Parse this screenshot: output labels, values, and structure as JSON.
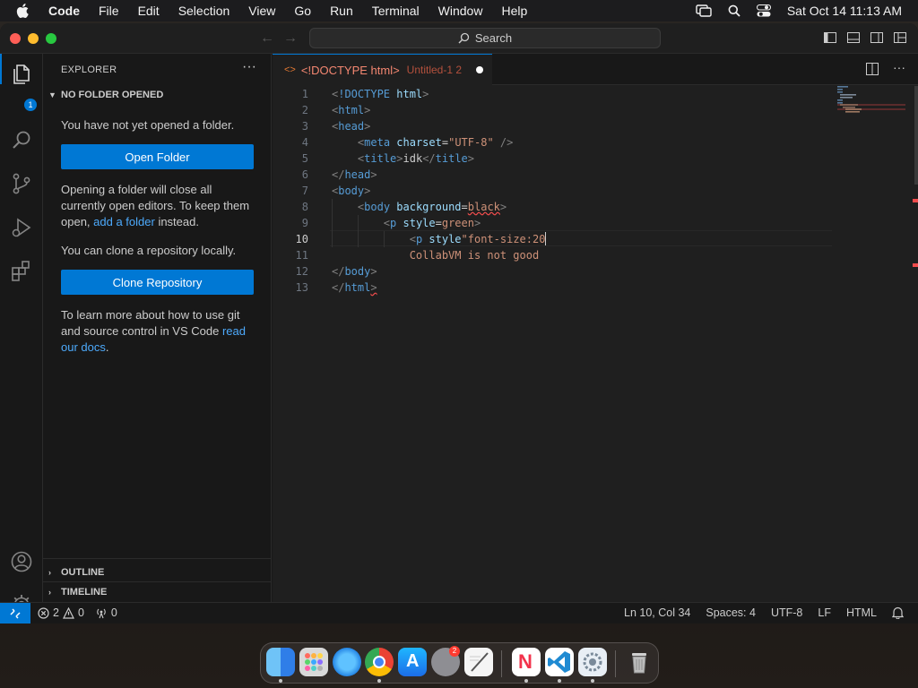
{
  "menubar": {
    "app_name": "Code",
    "items": [
      "File",
      "Edit",
      "Selection",
      "View",
      "Go",
      "Run",
      "Terminal",
      "Window",
      "Help"
    ],
    "datetime": "Sat Oct 14  11:13 AM"
  },
  "titlebar": {
    "search_label": "Search"
  },
  "activity": {
    "explorer_badge": "1"
  },
  "sidebar": {
    "header": "EXPLORER",
    "more": "···",
    "section_title": "NO FOLDER OPENED",
    "no_folder_text": "You have not yet opened a folder.",
    "open_folder_button": "Open Folder",
    "opening_text_1": "Opening a folder will close all currently open editors. To keep them open, ",
    "add_folder_link": "add a folder",
    "opening_text_2": " instead.",
    "clone_text": "You can clone a repository locally.",
    "clone_button": "Clone Repository",
    "git_text": "To learn more about how to use git and source control in VS Code ",
    "read_docs_link": "read our docs",
    "git_text_end": ".",
    "outline": "OUTLINE",
    "timeline": "TIMELINE"
  },
  "editor": {
    "tab_icon": "<>",
    "tab_title": "<!DOCTYPE html>",
    "tab_subtitle": "Untitled-1 2",
    "lines": [
      {
        "n": "1",
        "t": "<!DOCTYPE html>"
      },
      {
        "n": "2",
        "t": "<html>"
      },
      {
        "n": "3",
        "t": "<head>"
      },
      {
        "n": "4",
        "t": "    <meta charset=\"UTF-8\" />"
      },
      {
        "n": "5",
        "t": "    <title>idk</title>"
      },
      {
        "n": "6",
        "t": "</head>"
      },
      {
        "n": "7",
        "t": "<body>"
      },
      {
        "n": "8",
        "t": "    <body background=black>"
      },
      {
        "n": "9",
        "t": "        <p style=green>"
      },
      {
        "n": "10",
        "t": "            <p style\"font-size:20"
      },
      {
        "n": "11",
        "t": "            CollabVM is not good"
      },
      {
        "n": "12",
        "t": "</body>"
      },
      {
        "n": "13",
        "t": "</html>"
      }
    ],
    "active_line": "10"
  },
  "statusbar": {
    "errors": "2",
    "warnings": "0",
    "ports": "0",
    "position": "Ln 10, Col 34",
    "spaces": "Spaces: 4",
    "encoding": "UTF-8",
    "eol": "LF",
    "language": "HTML"
  },
  "dock": {
    "settings_badge": "2"
  },
  "colors": {
    "accent": "#0078d4",
    "link": "#4daafc",
    "tag": "#569cd6",
    "attribute": "#9cdcfe",
    "string": "#ce9178",
    "error": "#f14c4c"
  }
}
